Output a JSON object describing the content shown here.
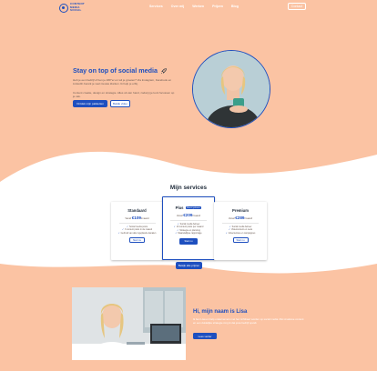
{
  "brand": {
    "logo_lines": [
      "CONTENT",
      "MEDIA",
      "SOCIAL"
    ],
    "accent": "#1e4fbf",
    "background": "#fbc3a3"
  },
  "nav": {
    "items": [
      {
        "label": "Services"
      },
      {
        "label": "Over mij"
      },
      {
        "label": "Werken"
      },
      {
        "label": "Prijzen"
      },
      {
        "label": "Blog"
      }
    ],
    "contact_label": "Contact"
  },
  "hero": {
    "title": "Stay on top of social media",
    "icon": "rocket-icon",
    "paragraph1": "Heb je een bedrijf of ben je ZZP'er en wil je groeien? Via Instagram, Facebook en LinkedIn bereik je veel nieuwe klanten. Ik help je erbij.",
    "paragraph2": "Content creatie, design en strategie. Alles uit één hand, zodat jij je kunt focussen op je vak.",
    "primary_button": "Ontdek mijn pakketten",
    "secondary_button": "Bekijk video"
  },
  "services": {
    "title": "Mijn services",
    "cards": [
      {
        "name": "Standaard",
        "price_prefix": "Vanaf",
        "price": "€109",
        "price_suffix": "/maand",
        "badge": "",
        "features": [
          "Social media posts",
          "3 content posts in de maand",
          "Gebruik van alle ingeplande kanalen"
        ],
        "button": "Start nu"
      },
      {
        "name": "Plus",
        "price_prefix": "Vanaf",
        "price": "€209",
        "price_suffix": "/maand",
        "badge": "Meest gekozen",
        "features": [
          "Social media beheer",
          "10 content posts per maand",
          "Strategie en planning",
          "Maandelijkse rapportage"
        ],
        "button": "Start nu"
      },
      {
        "name": "Premium",
        "price_prefix": "Vanaf",
        "price": "€289",
        "price_suffix": "/maand",
        "badge": "",
        "features": [
          "Social media beheer",
          "Videocontent en reels",
          "Advertenties en campagnes"
        ],
        "button": "Start nu"
      }
    ],
    "view_all_button": "Bekijk alle prijzen"
  },
  "about": {
    "title": "Hi, mijn naam is Lisa",
    "text": "Ik ben Lisa en help ondernemers met het zichtbaar worden op social media. Met creatieve content en een duidelijke strategie zorg ik dat jouw bedrijf opvalt.",
    "button": "Lees verder"
  }
}
